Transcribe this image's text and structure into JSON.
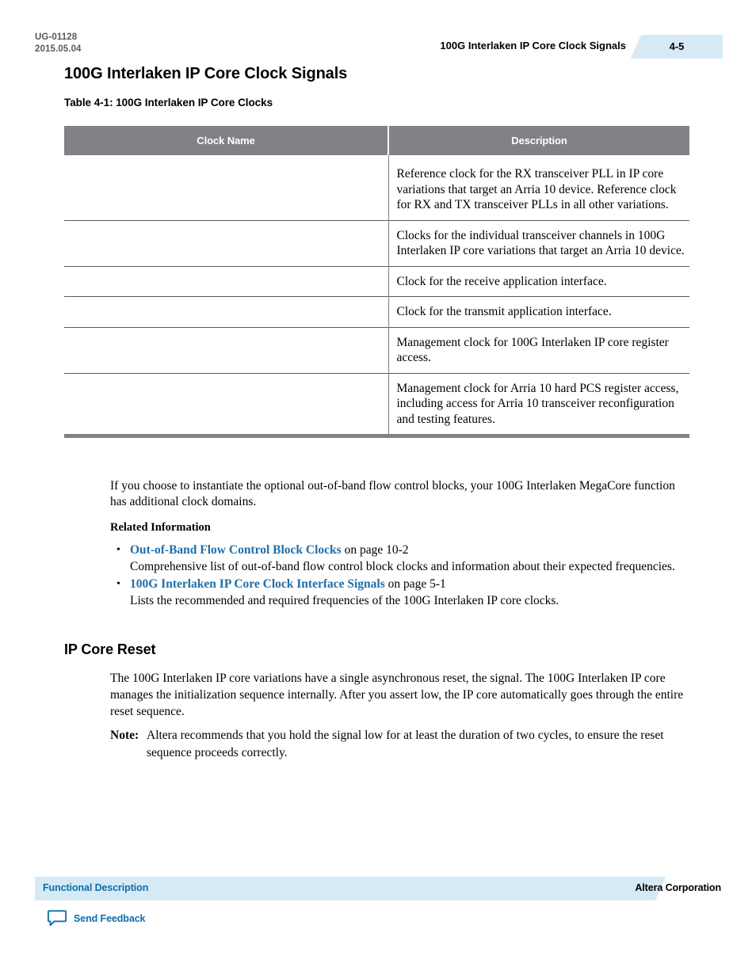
{
  "header": {
    "doc_number": "UG-01128",
    "doc_date": "2015.05.04",
    "running_title": "100G Interlaken IP Core Clock Signals",
    "page_number": "4-5"
  },
  "section": {
    "title": "100G Interlaken IP Core Clock Signals",
    "table_caption": "Table 4-1: 100G Interlaken IP Core Clocks"
  },
  "table": {
    "columns": [
      "Clock Name",
      "Description"
    ],
    "rows": [
      {
        "clock_name": "",
        "description": "Reference clock for the RX transceiver PLL in IP core variations that target an Arria 10 device. Reference clock for RX and TX transceiver PLLs in all other variations."
      },
      {
        "clock_name": "",
        "description": "Clocks for the individual transceiver channels in 100G Interlaken IP core variations that target an Arria 10 device."
      },
      {
        "clock_name": "",
        "description": "Clock for the receive application interface."
      },
      {
        "clock_name": "",
        "description": "Clock for the transmit application interface."
      },
      {
        "clock_name": "",
        "description": "Management clock for 100G Interlaken IP core register access."
      },
      {
        "clock_name": "",
        "description": "Management clock for Arria 10 hard PCS register access, including access for Arria 10 transceiver reconfiguration and testing features."
      }
    ]
  },
  "body": {
    "paragraph_after_table": "If you choose to instantiate the optional out-of-band flow control blocks, your 100G Interlaken MegaCore function has additional clock domains.",
    "related_information_heading": "Related Information",
    "related_links": [
      {
        "link_text": "Out-of-Band Flow Control Block Clocks",
        "page_ref": " on page 10-2",
        "description": "Comprehensive list of out-of-band flow control block clocks and information about their expected frequencies."
      },
      {
        "link_text": "100G Interlaken IP Core Clock Interface Signals",
        "page_ref": " on page 5-1",
        "description": "Lists the recommended and required frequencies of the 100G Interlaken IP core clocks."
      }
    ]
  },
  "reset_section": {
    "title": "IP Core Reset",
    "paragraph_part1": "The 100G Interlaken IP core variations have a single asynchronous reset, the ",
    "signal_1": "",
    "paragraph_part2": " signal. The 100G Interlaken IP core manages the initialization sequence internally. After you assert ",
    "signal_2": "",
    "paragraph_part3": " low, the IP core automatically goes through the entire reset sequence.",
    "note_label": "Note:",
    "note_part1": "Altera recommends that you hold the ",
    "note_signal": "",
    "note_part2": " signal low for at least the duration of two ",
    "note_signal_2": "",
    "note_part3": "cycles, to ensure the reset sequence proceeds correctly."
  },
  "footer": {
    "left_label": "Functional Description",
    "right_label": "Altera Corporation",
    "feedback_label": "Send Feedback"
  },
  "colors": {
    "badge_blue": "#d5eaf4",
    "link_blue": "#1f6fa8",
    "footer_blue": "#0f6ea8",
    "table_header_gray": "#808285"
  }
}
